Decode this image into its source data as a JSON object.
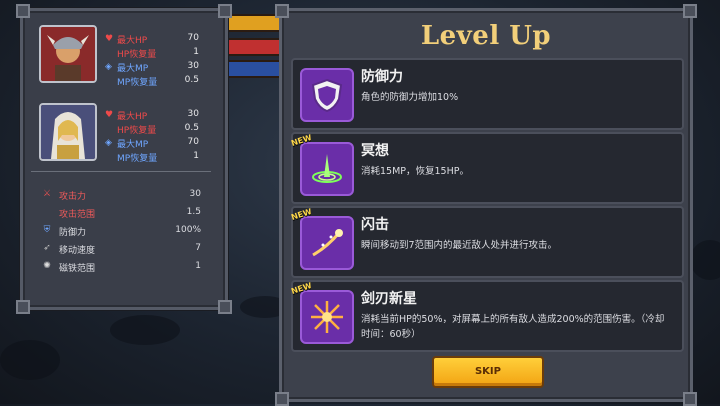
{
  "heroes": [
    {
      "name": "warrior",
      "stats": [
        {
          "label": "最大HP",
          "value": "70",
          "color": "#ee4a4a",
          "icon": "heart-icon"
        },
        {
          "label": "HP恢复量",
          "value": "1",
          "color": "#ee4a4a",
          "icon": ""
        },
        {
          "label": "最大MP",
          "value": "30",
          "color": "#6fa6ff",
          "icon": "diamond-icon"
        },
        {
          "label": "MP恢复量",
          "value": "0.5",
          "color": "#6fa6ff",
          "icon": ""
        }
      ]
    },
    {
      "name": "mage",
      "stats": [
        {
          "label": "最大HP",
          "value": "30",
          "color": "#ee4a4a",
          "icon": "heart-icon"
        },
        {
          "label": "HP恢复量",
          "value": "0.5",
          "color": "#ee4a4a",
          "icon": ""
        },
        {
          "label": "最大MP",
          "value": "70",
          "color": "#6fa6ff",
          "icon": "diamond-icon"
        },
        {
          "label": "MP恢复量",
          "value": "1",
          "color": "#6fa6ff",
          "icon": ""
        }
      ]
    }
  ],
  "party_stats": [
    {
      "label": "攻击力",
      "value": "30",
      "icon": "sword-icon"
    },
    {
      "label": "攻击范围",
      "value": "1.5",
      "icon": ""
    },
    {
      "label": "防御力",
      "value": "100%",
      "icon": "shield-icon"
    },
    {
      "label": "移动速度",
      "value": "7",
      "icon": "boot-icon"
    },
    {
      "label": "磁铁范围",
      "value": "1",
      "icon": "magnet-icon"
    }
  ],
  "level_up": {
    "title": "Level Up",
    "new_tag": "NEW",
    "options": [
      {
        "name": "防御力",
        "desc": "角色的防御力增加10%",
        "is_new": false,
        "icon": "shield-icon"
      },
      {
        "name": "冥想",
        "desc": "消耗15MP，恢复15HP。",
        "is_new": true,
        "icon": "meditation-icon"
      },
      {
        "name": "闪击",
        "desc": "瞬间移动到7范围内的最近敌人处并进行攻击。",
        "is_new": true,
        "icon": "flash-strike-icon"
      },
      {
        "name": "剑刃新星",
        "desc": "消耗当前HP的50%，对屏幕上的所有敌人造成200%的范围伤害。（冷却时间：60秒）",
        "is_new": true,
        "icon": "blade-nova-icon"
      }
    ],
    "skip_label": "SKIP"
  },
  "colors": {
    "title": "#f2cf7a",
    "hp": "#ee4a4a",
    "mp": "#6fa6ff",
    "skip": "#f2a312"
  }
}
